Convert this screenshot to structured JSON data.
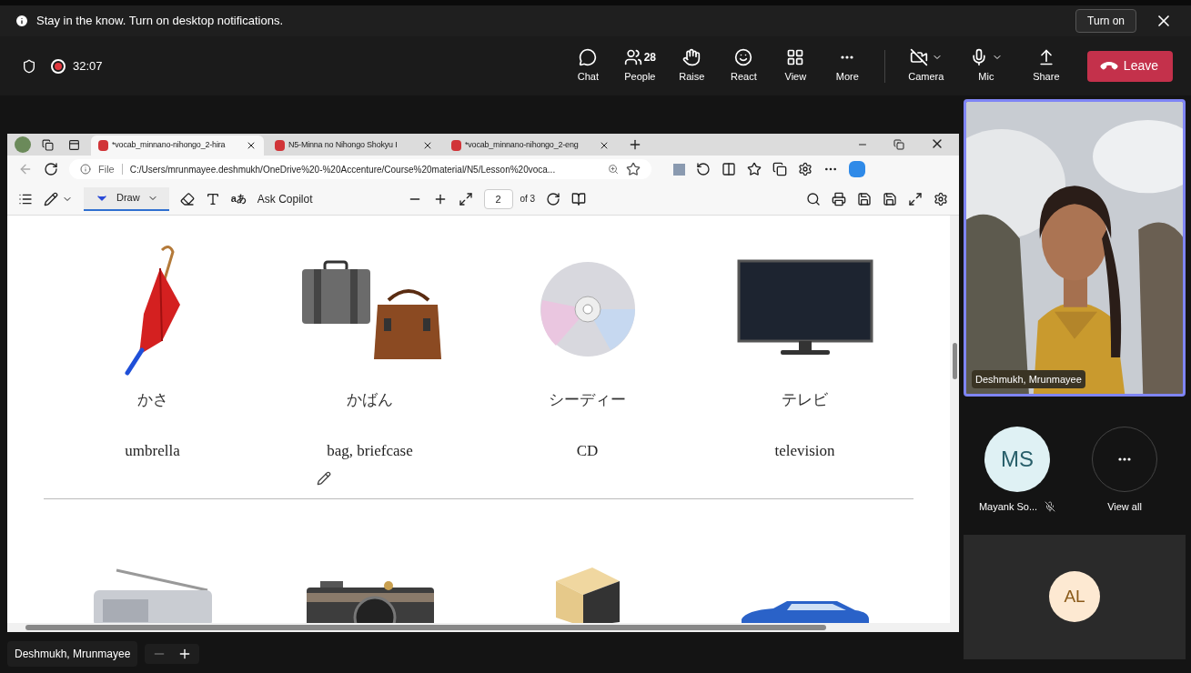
{
  "notification": {
    "text": "Stay in the know. Turn on desktop notifications.",
    "button": "Turn on"
  },
  "meeting": {
    "timer": "32:07",
    "recording": true
  },
  "toolbar": {
    "items": [
      {
        "kind": "chat",
        "label": "Chat"
      },
      {
        "kind": "people",
        "label": "People",
        "count": "28"
      },
      {
        "kind": "raise",
        "label": "Raise"
      },
      {
        "kind": "react",
        "label": "React"
      },
      {
        "kind": "view",
        "label": "View"
      },
      {
        "kind": "more",
        "label": "More"
      }
    ],
    "devices": [
      {
        "kind": "camera",
        "label": "Camera",
        "on": false
      },
      {
        "kind": "mic",
        "label": "Mic",
        "on": true
      },
      {
        "kind": "share",
        "label": "Share"
      }
    ],
    "leave": "Leave"
  },
  "browser": {
    "tabs": [
      {
        "title": "*vocab_minnano-nihongo_2-hira",
        "selected": true
      },
      {
        "title": "N5-Minna no Nihongo Shokyu I",
        "selected": false
      },
      {
        "title": "*vocab_minnano-nihongo_2-eng",
        "selected": false
      }
    ],
    "address": {
      "scheme": "File",
      "url": "C:/Users/mrunmayee.deshmukh/OneDrive%20-%20Accenture/Course%20material/N5/Lesson%20voca..."
    },
    "pdf_toolbar": {
      "draw": "Draw",
      "read_aloud": "aあ",
      "copilot": "Ask Copilot",
      "page": "2",
      "page_count": "of 3"
    },
    "vocab": [
      {
        "reading": "かさ",
        "meaning": "umbrella"
      },
      {
        "reading": "かばん",
        "meaning": "bag, briefcase"
      },
      {
        "reading": "シーディー",
        "meaning": "CD"
      },
      {
        "reading": "テレビ",
        "meaning": "television"
      }
    ]
  },
  "presenter": {
    "name": "Deshmukh, Mrunmayee"
  },
  "featured": {
    "name": "Deshmukh, Mrunmayee"
  },
  "participants": [
    {
      "initials": "MS",
      "name": "Mayank So...",
      "muted": true,
      "color": "#dff1f4"
    }
  ],
  "view_all": "View all",
  "bottom_tile": {
    "initials": "AL",
    "color": "#fde9d2"
  }
}
